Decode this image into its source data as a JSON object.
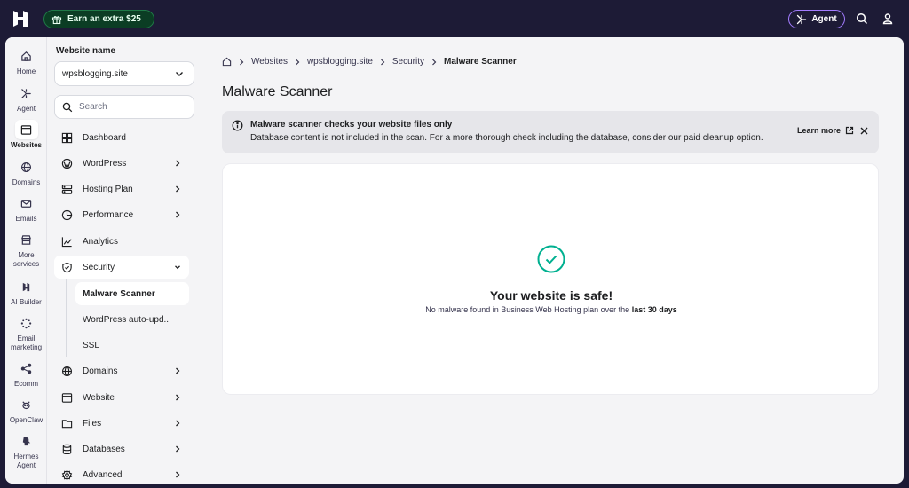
{
  "topbar": {
    "promo_label": "Earn an extra $25",
    "agent_label": "Agent"
  },
  "rail": [
    {
      "label": "Home",
      "icon": "home-icon"
    },
    {
      "label": "Agent",
      "icon": "agent-sparkle-icon"
    },
    {
      "label": "Websites",
      "icon": "browser-window-icon",
      "active": true
    },
    {
      "label": "Domains",
      "icon": "globe-icon"
    },
    {
      "label": "Emails",
      "icon": "mail-icon"
    },
    {
      "label": "More services",
      "icon": "store-icon"
    },
    {
      "label": "AI Builder",
      "icon": "ai-builder-icon"
    },
    {
      "label": "Email marketing",
      "icon": "email-marketing-icon"
    },
    {
      "label": "Ecomm",
      "icon": "share-nodes-icon"
    },
    {
      "label": "OpenClaw",
      "icon": "claw-icon"
    },
    {
      "label": "Hermes Agent",
      "icon": "hermes-icon"
    }
  ],
  "sidebar": {
    "title": "Website name",
    "selected_site": "wpsblogging.site",
    "search_placeholder": "Search",
    "items": [
      {
        "label": "Dashboard",
        "icon": "dashboard-grid-icon"
      },
      {
        "label": "WordPress",
        "icon": "wordpress-icon"
      },
      {
        "label": "Hosting Plan",
        "icon": "server-icon"
      },
      {
        "label": "Performance",
        "icon": "pie-chart-icon"
      },
      {
        "label": "Analytics",
        "icon": "analytics-line-icon"
      },
      {
        "label": "Security",
        "icon": "shield-check-icon"
      },
      {
        "label": "Domains",
        "icon": "globe-icon"
      },
      {
        "label": "Website",
        "icon": "browser-window-icon"
      },
      {
        "label": "Files",
        "icon": "folder-icon"
      },
      {
        "label": "Databases",
        "icon": "database-icon"
      },
      {
        "label": "Advanced",
        "icon": "gear-icon"
      }
    ],
    "security_sub": [
      {
        "label": "Malware Scanner",
        "active": true
      },
      {
        "label": "WordPress auto-upd..."
      },
      {
        "label": "SSL"
      }
    ]
  },
  "breadcrumb": [
    "wpsblogging.site",
    "Websites",
    "Security",
    "Malware Scanner"
  ],
  "page": {
    "title": "Malware Scanner",
    "alert_title": "Malware scanner checks your website files only",
    "alert_desc": "Database content is not included in the scan. For a more thorough check including the database, consider our paid cleanup option.",
    "learn_more": "Learn more",
    "result_title": "Your website is safe!",
    "result_desc": "No malware found in Business Web Hosting plan over the",
    "result_period": "last 30 days"
  },
  "colors": {
    "topbar_bg": "#1d1b36",
    "promo_bg": "#0b3d24",
    "agent_border": "#a37cff",
    "success": "#00b090"
  }
}
